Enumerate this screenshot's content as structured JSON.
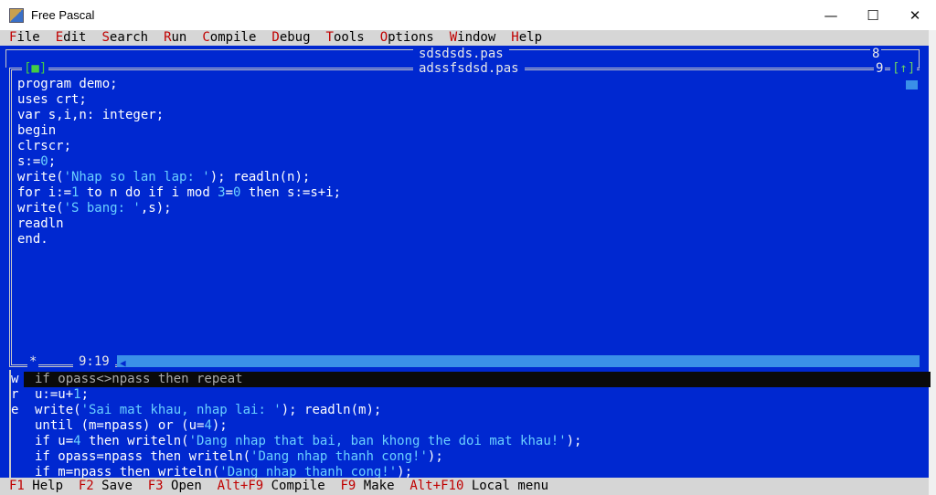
{
  "window": {
    "title": "Free Pascal",
    "minimize": "—",
    "maximize": "☐",
    "close": "✕"
  },
  "menu": [
    {
      "hotkey": "F",
      "rest": "ile"
    },
    {
      "hotkey": "E",
      "rest": "dit"
    },
    {
      "hotkey": "S",
      "rest": "earch"
    },
    {
      "hotkey": "R",
      "rest": "un"
    },
    {
      "hotkey": "C",
      "rest": "ompile"
    },
    {
      "hotkey": "D",
      "rest": "ebug"
    },
    {
      "hotkey": "T",
      "rest": "ools"
    },
    {
      "hotkey": "O",
      "rest": "ptions"
    },
    {
      "hotkey": "W",
      "rest": "indow"
    },
    {
      "hotkey": "H",
      "rest": "elp"
    }
  ],
  "back_window": {
    "title": "sdsdsds.pas",
    "number": "8"
  },
  "editor": {
    "title": "adssfsdsd.pas",
    "number": "9",
    "close_box": "[■]",
    "zoom_box": "[↑]",
    "modified": "*",
    "cursor_pos": "9:19",
    "lines": [
      [
        [
          "t",
          "program demo;"
        ]
      ],
      [
        [
          "t",
          "uses crt;"
        ]
      ],
      [
        [
          "t",
          "var s,i,n: integer;"
        ]
      ],
      [
        [
          "t",
          "begin"
        ]
      ],
      [
        [
          "t",
          "clrscr;"
        ]
      ],
      [
        [
          "t",
          "s:="
        ],
        [
          "n",
          "0"
        ],
        [
          "t",
          ";"
        ]
      ],
      [
        [
          "t",
          "write("
        ],
        [
          "s",
          "'Nhap so lan lap: '"
        ],
        [
          "t",
          "); readln(n);"
        ]
      ],
      [
        [
          "t",
          "for i:="
        ],
        [
          "n",
          "1"
        ],
        [
          "t",
          " to n do if i mod "
        ],
        [
          "n",
          "3"
        ],
        [
          "t",
          "="
        ],
        [
          "n",
          "0"
        ],
        [
          "t",
          " then s:=s+i;"
        ]
      ],
      [
        [
          "t",
          "write("
        ],
        [
          "s",
          "'S bang: '"
        ],
        [
          "t",
          ",s);"
        ]
      ],
      [
        [
          "t",
          "readln"
        ]
      ],
      [
        [
          "t",
          "end."
        ]
      ]
    ]
  },
  "lower_window": {
    "side_chars": [
      "w",
      "r",
      "e"
    ],
    "highlight_line": "if opass<>npass then repeat",
    "lines": [
      [
        [
          "t",
          "u:=u+"
        ],
        [
          "n",
          "1"
        ],
        [
          "t",
          ";"
        ]
      ],
      [
        [
          "t",
          "write("
        ],
        [
          "s",
          "'Sai mat khau, nhap lai: '"
        ],
        [
          "t",
          "); readln(m);"
        ]
      ],
      [
        [
          "t",
          "until (m=npass) or (u="
        ],
        [
          "n",
          "4"
        ],
        [
          "t",
          ");"
        ]
      ],
      [
        [
          "t",
          "if u="
        ],
        [
          "n",
          "4"
        ],
        [
          "t",
          " then writeln("
        ],
        [
          "s",
          "'Dang nhap that bai, ban khong the doi mat khau!'"
        ],
        [
          "t",
          ");"
        ]
      ],
      [
        [
          "t",
          "if opass=npass then writeln("
        ],
        [
          "s",
          "'Dang nhap thanh cong!'"
        ],
        [
          "t",
          ");"
        ]
      ],
      [
        [
          "t",
          "if m=npass then writeln("
        ],
        [
          "s",
          "'Dang nhap thanh cong!'"
        ],
        [
          "t",
          ");"
        ]
      ]
    ]
  },
  "statusbar": [
    {
      "key": "F1",
      "label": "Help"
    },
    {
      "key": "F2",
      "label": "Save"
    },
    {
      "key": "F3",
      "label": "Open"
    },
    {
      "key": "Alt+F9",
      "label": "Compile"
    },
    {
      "key": "F9",
      "label": "Make"
    },
    {
      "key": "Alt+F10",
      "label": "Local menu"
    }
  ],
  "colors": {
    "desktop": "#0028d0",
    "string": "#6ad0ff",
    "hotkey": "#c00000",
    "scrollbar": "#3a90e8"
  }
}
